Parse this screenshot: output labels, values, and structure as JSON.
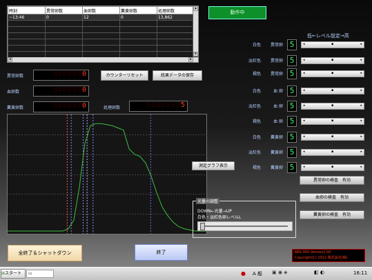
{
  "table": {
    "headers": [
      "時刻",
      "異常卵数",
      "血卵数",
      "糞黄卵数",
      "処理卵数"
    ],
    "rows": [
      [
        "~13:46",
        "0",
        "12",
        "0",
        "13,862"
      ],
      [
        "",
        "",
        "",
        "",
        ""
      ],
      [
        "",
        "",
        "",
        "",
        ""
      ],
      [
        "",
        "",
        "",
        "",
        ""
      ],
      [
        "",
        "",
        "",
        "",
        ""
      ],
      [
        "",
        "",
        "",
        "",
        ""
      ],
      [
        "",
        "",
        "",
        "",
        ""
      ],
      [
        "",
        "",
        "",
        "",
        ""
      ]
    ]
  },
  "status": "動作中",
  "counters": {
    "abnormal_label": "異常卵数",
    "abnormal_value": "0",
    "blood_label": "血卵数",
    "blood_value": "0",
    "dung_label": "糞黄卵数",
    "dung_value": "0",
    "processed_label": "処理卵数",
    "processed_value": "5"
  },
  "buttons": {
    "counter_reset": "カウンターリセット",
    "save_stats": "統果データの保存",
    "graph_display": "測定グラフ表示",
    "shutdown": "全終了＆シャットダウン",
    "exit": "終了"
  },
  "level_header": "低←レベル設定→高",
  "level_rows": [
    {
      "color": "白色",
      "type": "異常卵",
      "level": "5"
    },
    {
      "color": "淡紅色",
      "type": "異常卵",
      "level": "5"
    },
    {
      "color": "褐色",
      "type": "異常卵",
      "level": "5"
    },
    {
      "color": "白色",
      "type": "血 卵",
      "level": "5"
    },
    {
      "color": "淡紅色",
      "type": "血 卵",
      "level": "5"
    },
    {
      "color": "褐色",
      "type": "血 卵",
      "level": "5"
    },
    {
      "color": "白色",
      "type": "糞黄卵",
      "level": "5"
    },
    {
      "color": "淡紅色",
      "type": "糞黄卵",
      "level": "5"
    },
    {
      "color": "褐色",
      "type": "糞黄卵",
      "level": "5"
    }
  ],
  "detect_rows": [
    {
      "label": "異常卵の検査",
      "state": "有効"
    },
    {
      "label": "血卵の検査",
      "state": "有効"
    },
    {
      "label": "糞黄卵の検査",
      "state": "有効"
    }
  ],
  "light": {
    "title": "光量の調整",
    "line1": "DOWN←光量→UP",
    "line2": "白色・淡紅色卵レベルL"
  },
  "version": {
    "line1": "BBS-000 Version1.00",
    "line2": "Copyright(C) 2012 株式会社(株)"
  },
  "taskbar": {
    "start": "スタート",
    "ime": "A 般",
    "time": "16:11"
  },
  "colors": {
    "status_green": "#0d8f2a",
    "seg_red": "#ff3a1e",
    "seg_green": "#3dff6a",
    "graph_line": "#3fbf3f"
  },
  "chart_data": {
    "type": "line",
    "series": [
      {
        "values": [
          0,
          0,
          0,
          0,
          0,
          0,
          0,
          0,
          0,
          0,
          0,
          2,
          10,
          40,
          80,
          96,
          98,
          98,
          97,
          96,
          94,
          92,
          75,
          70,
          68,
          62,
          50,
          35,
          22,
          14,
          8,
          4,
          2,
          1,
          0,
          0,
          0
        ]
      }
    ],
    "markers": [
      0.3,
      0.32,
      0.38,
      0.4,
      0.43,
      0.72
    ],
    "ylim": [
      0,
      100
    ]
  }
}
